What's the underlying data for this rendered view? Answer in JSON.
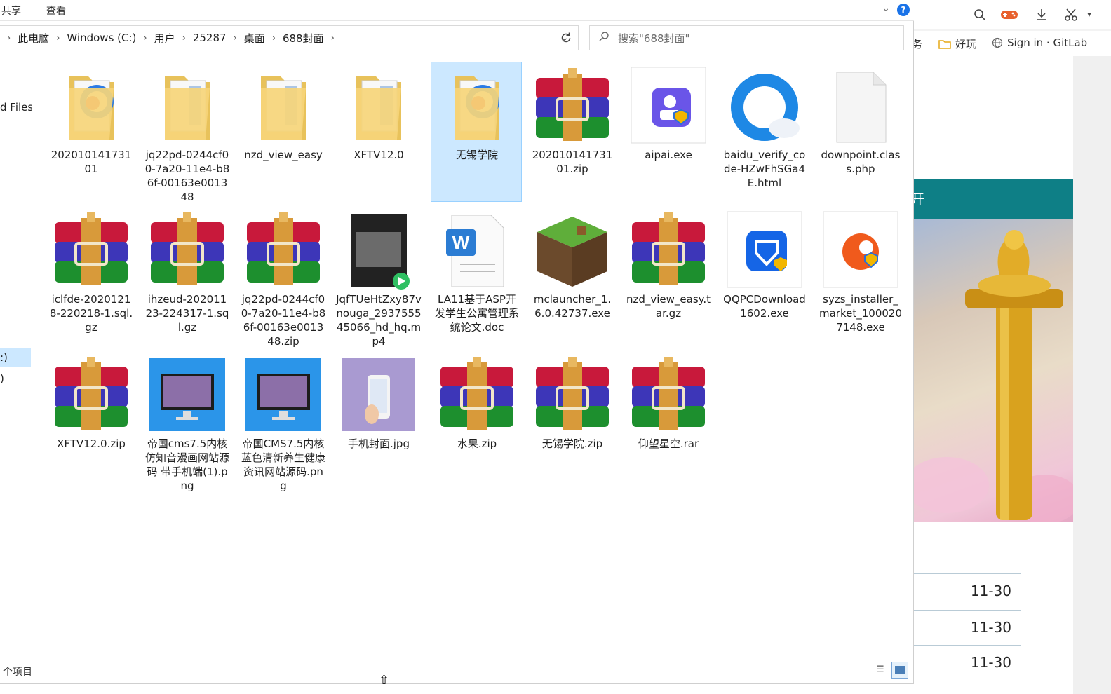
{
  "ribbon": {
    "tabs": [
      "共享",
      "查看"
    ],
    "help": "?"
  },
  "address": {
    "crumbs": [
      "此电脑",
      "Windows (C:)",
      "用户",
      "25287",
      "桌面",
      "688封面"
    ],
    "search_placeholder": "搜索\"688封面\""
  },
  "navpane": {
    "items": [
      "d Files",
      ":)",
      ")"
    ]
  },
  "files": [
    {
      "name": "20201014173101",
      "icon": "folder-icon",
      "selected": false
    },
    {
      "name": "jq22pd-0244cf00-7a20-11e4-b86f-00163e001348",
      "icon": "folder-icon",
      "selected": false
    },
    {
      "name": "nzd_view_easy",
      "icon": "folder-icon",
      "selected": false
    },
    {
      "name": "XFTV12.0",
      "icon": "folder-icon",
      "selected": false
    },
    {
      "name": "无锡学院",
      "icon": "folder-icon",
      "selected": true
    },
    {
      "name": "20201014173101.zip",
      "icon": "winrar-archive-icon",
      "selected": false
    },
    {
      "name": "aipai.exe",
      "icon": "exe-app-icon",
      "selected": false
    },
    {
      "name": "baidu_verify_code-HZwFhSGa4E.html",
      "icon": "browser-html-icon",
      "selected": false
    },
    {
      "name": "downpoint.class.php",
      "icon": "blank-file-icon",
      "selected": false
    },
    {
      "name": "iclfde-20201218-220218-1.sql.gz",
      "icon": "winrar-archive-icon",
      "selected": false
    },
    {
      "name": "ihzeud-20201123-224317-1.sql.gz",
      "icon": "winrar-archive-icon",
      "selected": false
    },
    {
      "name": "jq22pd-0244cf00-7a20-11e4-b86f-00163e001348.zip",
      "icon": "winrar-archive-icon",
      "selected": false
    },
    {
      "name": "JqfTUeHtZxy87vnouga_293755545066_hd_hq.mp4",
      "icon": "video-thumbnail-icon",
      "selected": false
    },
    {
      "name": "LA11基于ASP开发学生公寓管理系统论文.doc",
      "icon": "word-document-icon",
      "selected": false
    },
    {
      "name": "mclauncher_1.6.0.42737.exe",
      "icon": "minecraft-grass-block-icon",
      "selected": false
    },
    {
      "name": "nzd_view_easy.tar.gz",
      "icon": "winrar-archive-icon",
      "selected": false
    },
    {
      "name": "QQPCDownload1602.exe",
      "icon": "qq-pc-manager-icon",
      "selected": false
    },
    {
      "name": "syzs_installer_market_1000207148.exe",
      "icon": "installer-exe-icon",
      "selected": false
    },
    {
      "name": "XFTV12.0.zip",
      "icon": "winrar-archive-icon",
      "selected": false
    },
    {
      "name": "帝国cms7.5内核仿知音漫画网站源码 带手机端(1).png",
      "icon": "monitor-screenshot-icon",
      "selected": false
    },
    {
      "name": "帝国CMS7.5内核蓝色清新养生健康资讯网站源码.png",
      "icon": "monitor-screenshot-icon",
      "selected": false
    },
    {
      "name": "手机封面.jpg",
      "icon": "phone-cover-image-icon",
      "selected": false
    },
    {
      "name": "水果.zip",
      "icon": "winrar-archive-icon",
      "selected": false
    },
    {
      "name": "无锡学院.zip",
      "icon": "winrar-archive-icon",
      "selected": false
    },
    {
      "name": "仰望星空.rar",
      "icon": "winrar-archive-icon",
      "selected": false
    }
  ],
  "status": {
    "count_text": "个项目"
  },
  "browser": {
    "bookmarks": [
      "务",
      "好玩",
      "Sign in · GitLab"
    ],
    "banner_text": "开",
    "dates": [
      "11-30",
      "11-30",
      "11-30"
    ]
  },
  "colors": {
    "selection": "#cce8ff",
    "teal_banner": "#0e7f86",
    "help_blue": "#1a73e8"
  }
}
